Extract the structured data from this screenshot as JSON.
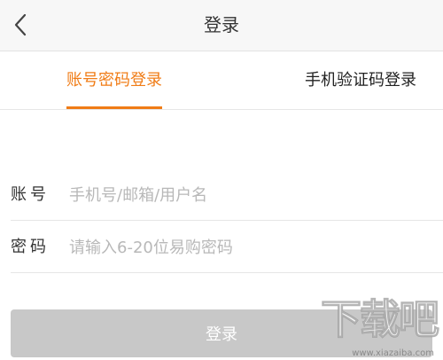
{
  "header": {
    "back_icon": "chevron-left-icon",
    "title": "登录"
  },
  "tabs": [
    {
      "label": "账号密码登录",
      "active": true
    },
    {
      "label": "手机验证码登录",
      "active": false
    }
  ],
  "form": {
    "account": {
      "label": "账号",
      "placeholder": "手机号/邮箱/用户名",
      "value": ""
    },
    "password": {
      "label": "密码",
      "placeholder": "请输入6-20位易购密码",
      "value": ""
    },
    "submit_label": "登录"
  },
  "watermark": {
    "text": "下载吧",
    "url": "www.xiazaiba.com"
  },
  "colors": {
    "accent": "#f07c16",
    "button_disabled": "#c8c8c8",
    "header_bg": "#f7f7f7",
    "text": "#333333",
    "placeholder": "#b8b8b8",
    "divider": "#e6e6e6"
  }
}
